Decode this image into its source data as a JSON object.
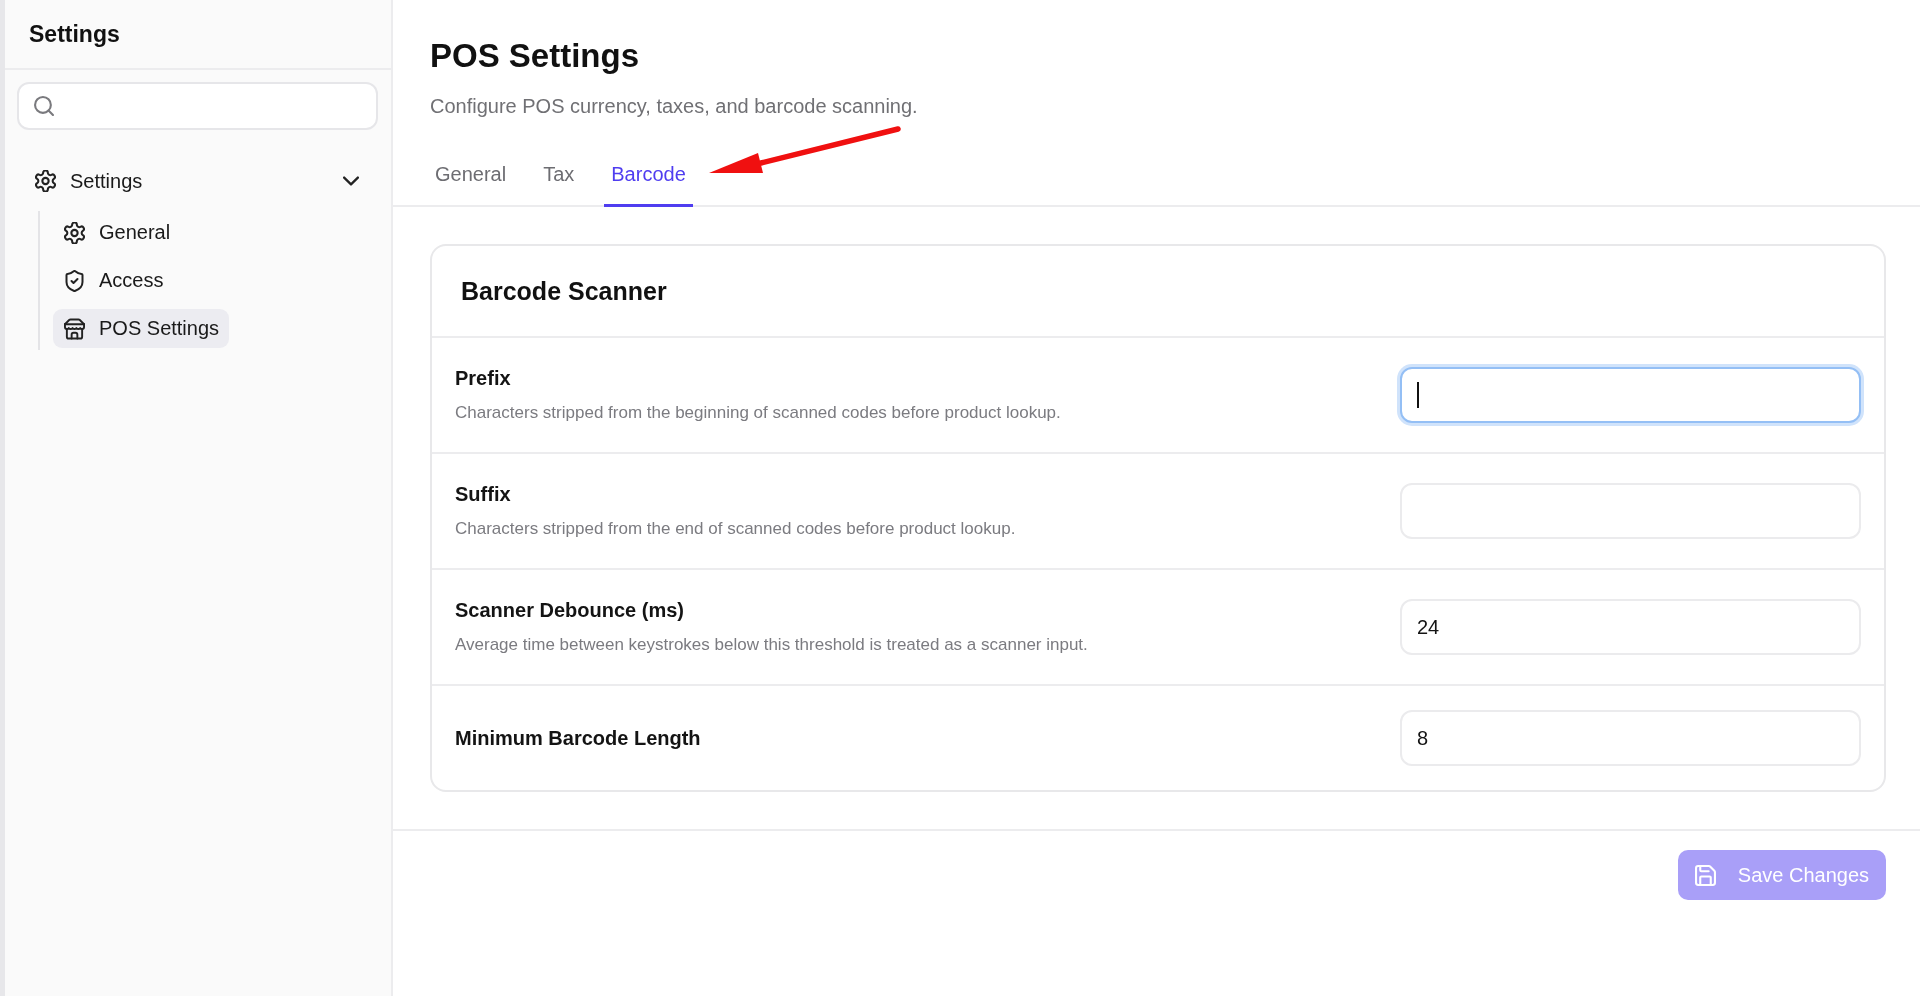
{
  "sidebar": {
    "title": "Settings",
    "nav": [
      {
        "label": "Settings",
        "selected": false,
        "expanded": true,
        "children": [
          {
            "label": "General",
            "selected": false
          },
          {
            "label": "Access",
            "selected": false
          },
          {
            "label": "POS Settings",
            "selected": true
          }
        ]
      }
    ]
  },
  "page": {
    "title": "POS Settings",
    "subtitle": "Configure POS currency, taxes, and barcode scanning."
  },
  "tabs": [
    {
      "label": "General",
      "selected": false
    },
    {
      "label": "Tax",
      "selected": false
    },
    {
      "label": "Barcode",
      "selected": true
    }
  ],
  "card": {
    "title": "Barcode Scanner",
    "fields": [
      {
        "label": "Prefix",
        "description": "Characters stripped from the beginning of scanned codes before product lookup.",
        "focused": true
      },
      {
        "label": "Suffix",
        "description": "Characters stripped from the end of scanned codes before product lookup.",
        "focused": false
      },
      {
        "label": "Scanner Debounce (ms)",
        "description": "Average time between keystrokes below this threshold is treated as a scanner input.",
        "value": "24",
        "focused": false
      },
      {
        "label": "Minimum Barcode Length",
        "value": "8",
        "focused": false
      }
    ]
  },
  "save_button": {
    "label": "Save Changes",
    "disabled": true
  }
}
